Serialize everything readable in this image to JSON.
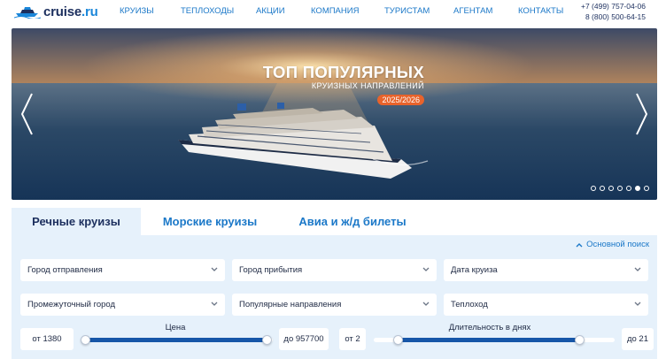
{
  "header": {
    "logo": {
      "name": "cruise",
      "tld": ".ru"
    },
    "nav": [
      "КРУИЗЫ",
      "ТЕПЛОХОДЫ",
      "АКЦИИ",
      "КОМПАНИЯ",
      "ТУРИСТАМ",
      "АГЕНТАМ",
      "КОНТАКТЫ"
    ],
    "phones": [
      "+7 (499) 757-04-06",
      "8 (800) 500-64-15"
    ]
  },
  "hero": {
    "title": "ТОП ПОПУЛЯРНЫХ",
    "subtitle": "КРУИЗНЫХ НАПРАВЛЕНИЙ",
    "badge": "2025/2026",
    "slide_count": 7,
    "active_slide": 5
  },
  "search": {
    "tabs": [
      "Речные круизы",
      "Морские круизы",
      "Авиа и ж/д билеты"
    ],
    "active_tab": 0,
    "basic_search_label": "Основной поиск",
    "fields": {
      "departure_city": "Город отправления",
      "arrival_city": "Город прибытия",
      "cruise_date": "Дата круиза",
      "intermediate_city": "Промежуточный город",
      "popular_directions": "Популярные направления",
      "ship": "Теплоход"
    },
    "price": {
      "label": "Цена",
      "from": "от 1380",
      "to": "до 957700"
    },
    "duration": {
      "label": "Длительность в днях",
      "from": "от 2",
      "to": "до 21"
    }
  },
  "colors": {
    "accent": "#1b78c8",
    "brand_dark": "#1c2f5e",
    "badge": "#e8632b",
    "panel_bg": "#e6f1fb",
    "slider_fill": "#1656a8"
  }
}
